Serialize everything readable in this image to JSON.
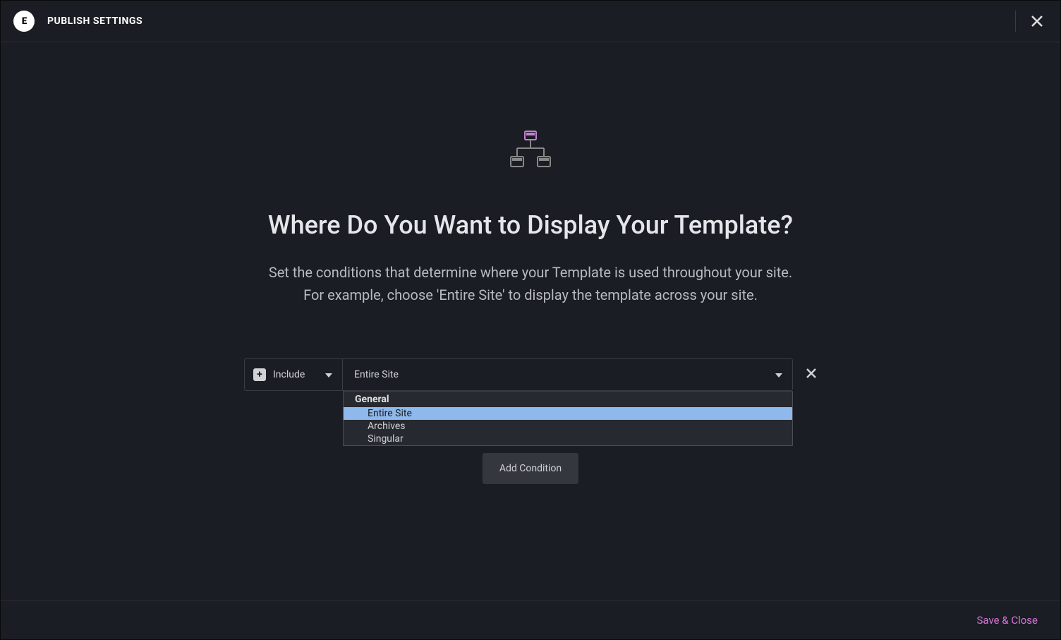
{
  "header": {
    "title": "PUBLISH SETTINGS",
    "logo_text": "E"
  },
  "main": {
    "heading": "Where Do You Want to Display Your Template?",
    "description_line1": "Set the conditions that determine where your Template is used throughout your site.",
    "description_line2": "For example, choose 'Entire Site' to display the template across your site."
  },
  "condition": {
    "mode_label": "Include",
    "scope_selected": "Entire Site"
  },
  "dropdown": {
    "group": "General",
    "options": [
      "Entire Site",
      "Archives",
      "Singular"
    ],
    "selected_index": 0
  },
  "buttons": {
    "add_condition": "Add Condition",
    "save_close": "Save & Close"
  }
}
